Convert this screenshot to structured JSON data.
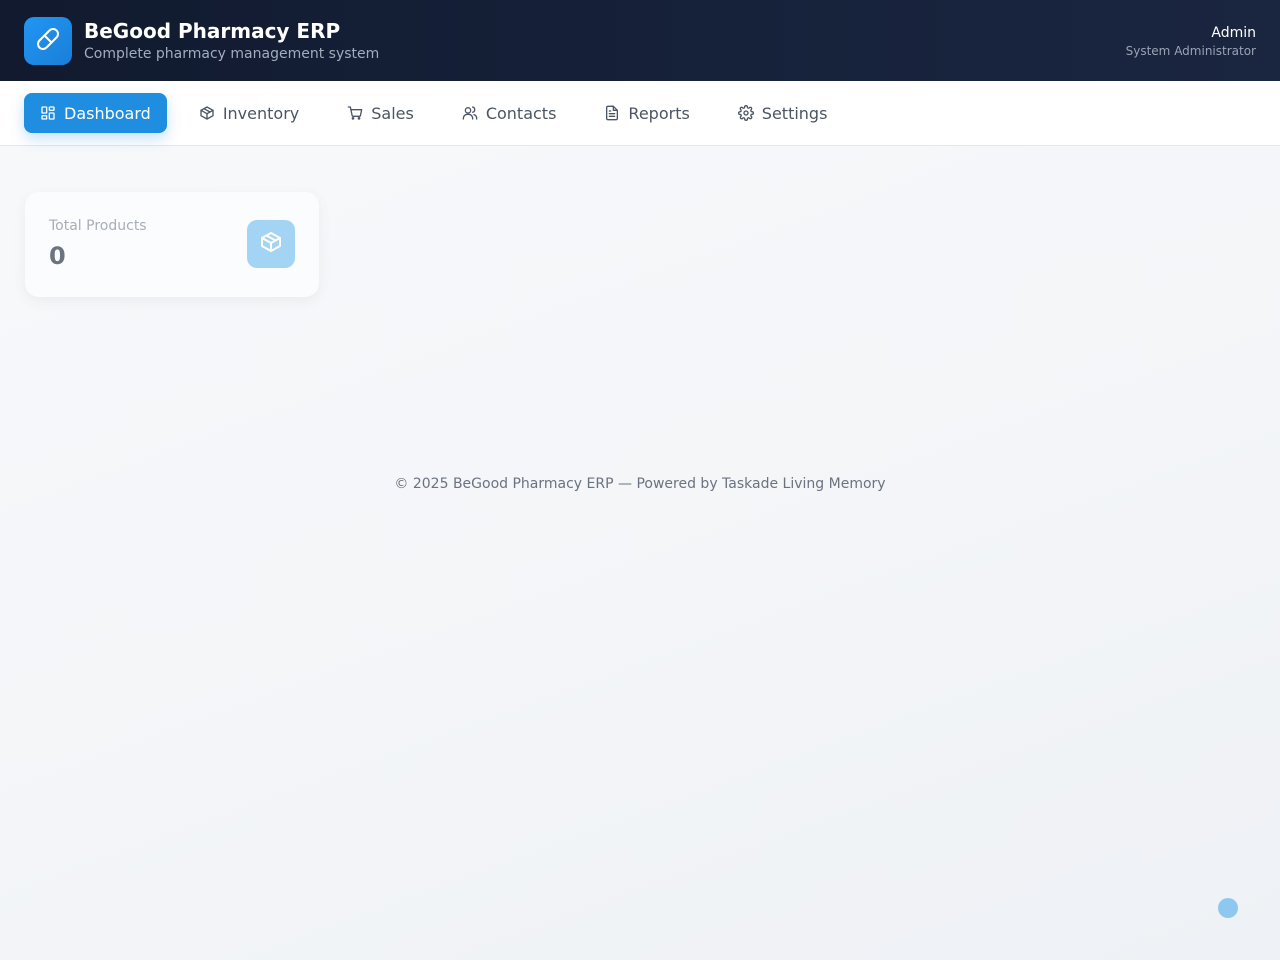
{
  "app": {
    "title": "BeGood Pharmacy ERP",
    "subtitle": "Complete pharmacy management system",
    "logo_icon": "pill-icon",
    "accent_color": "#1f8de0"
  },
  "user": {
    "name": "Admin",
    "role": "System Administrator"
  },
  "nav": {
    "items": [
      {
        "label": "Dashboard",
        "icon": "dashboard-icon",
        "active": true
      },
      {
        "label": "Inventory",
        "icon": "package-icon",
        "active": false
      },
      {
        "label": "Sales",
        "icon": "cart-icon",
        "active": false
      },
      {
        "label": "Contacts",
        "icon": "users-icon",
        "active": false
      },
      {
        "label": "Reports",
        "icon": "document-icon",
        "active": false
      },
      {
        "label": "Settings",
        "icon": "gear-icon",
        "active": false
      }
    ]
  },
  "stats": {
    "total_products": {
      "label": "Total Products",
      "value": "0",
      "icon": "package-icon"
    }
  },
  "footer": {
    "text": "© 2025 BeGood Pharmacy ERP — Powered by Taskade Living Memory"
  }
}
